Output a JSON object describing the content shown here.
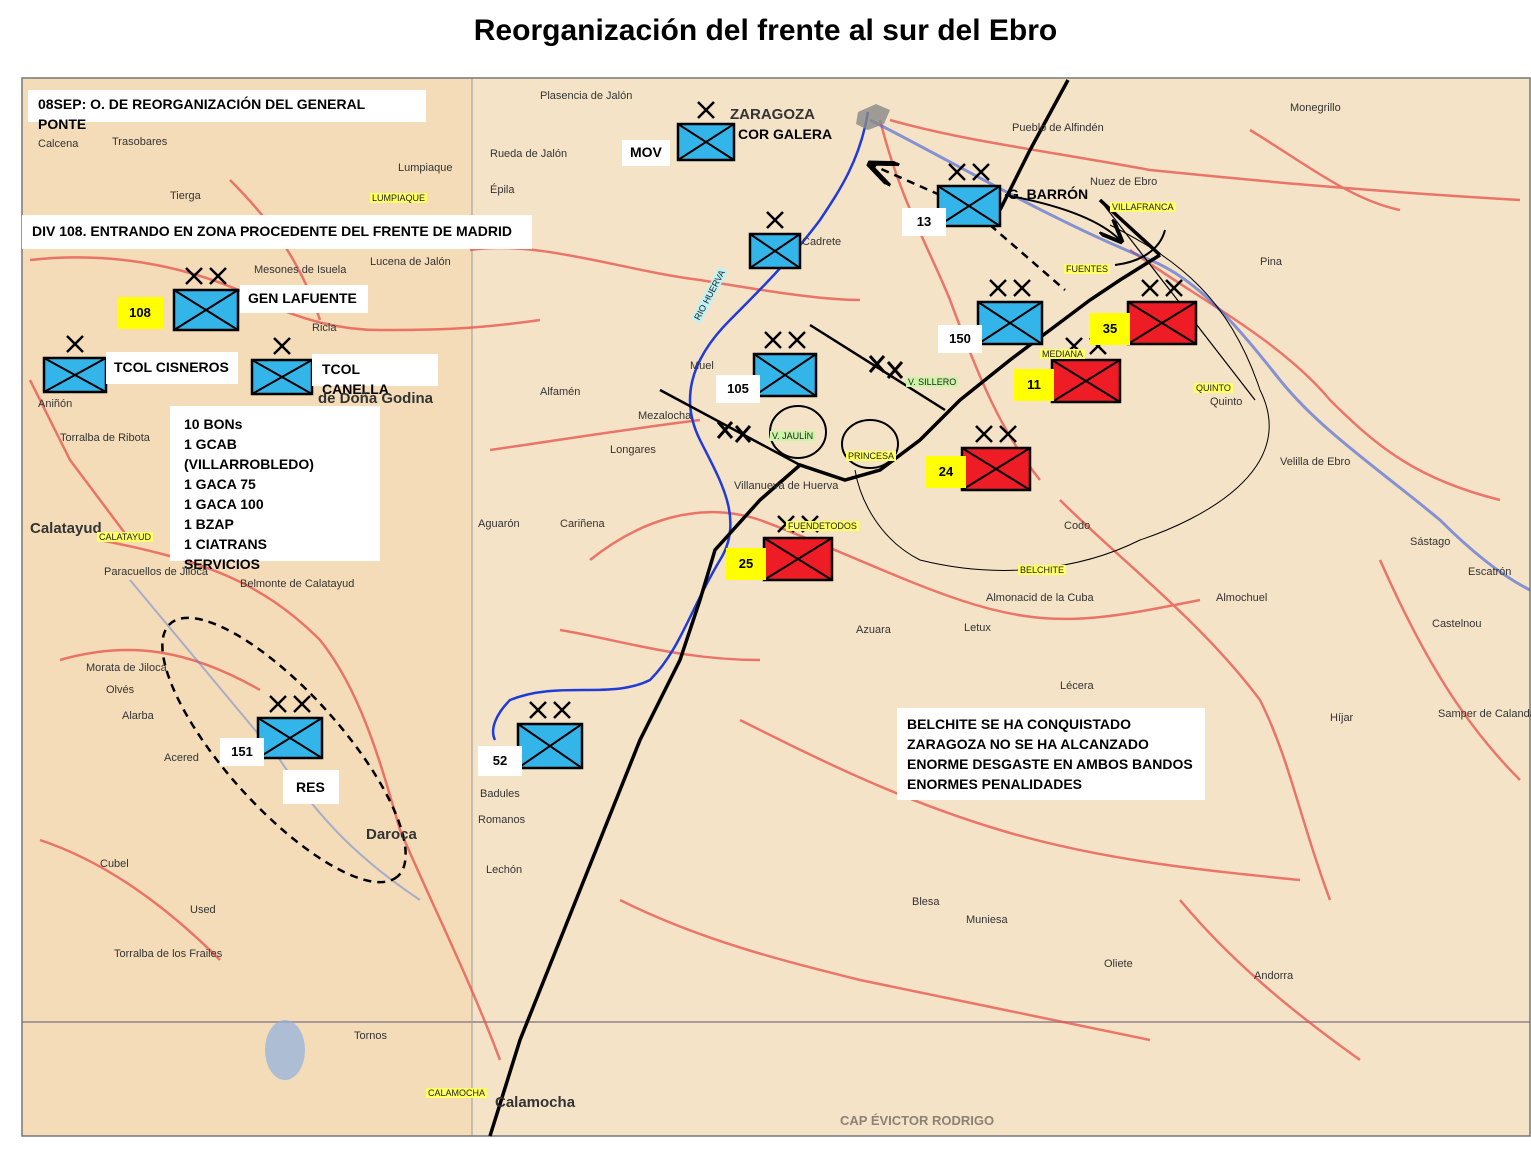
{
  "title": "Reorganización del frente al sur del Ebro",
  "notes": {
    "order": "08SEP: O. DE REORGANIZACIÓN DEL GENERAL PONTE",
    "div108": "DIV 108. ENTRANDO EN ZONA PROCEDENTE DEL FRENTE DE MADRID",
    "composition": [
      "10 BONs",
      "1 GCAB (VILLARROBLEDO)",
      "1 GACA 75",
      "1 GACA 100",
      "1 BZAP",
      "1 CIATRANS",
      "SERVICIOS"
    ],
    "summary": [
      "BELCHITE SE HA CONQUISTADO",
      "ZARAGOZA NO SE HA ALCANZADO",
      "ENORME DESGASTE EN AMBOS BANDOS",
      "ENORMES PENALIDADES"
    ]
  },
  "unit_labels": {
    "mov": "MOV",
    "cor_galera": "COR GALERA",
    "g_barron": "G. BARRÓN",
    "gen_lafuente": "GEN LAFUENTE",
    "tcol_cisneros": "TCOL CISNEROS",
    "tcol_canella": "TCOL CANELLA",
    "res": "RES"
  },
  "unit_numbers": {
    "u108": "108",
    "u13": "13",
    "u150": "150",
    "u105": "105",
    "u151": "151",
    "u52": "52",
    "u35": "35",
    "u11": "11",
    "u24": "24",
    "u25": "25"
  },
  "map_labels": {
    "zaragoza": "ZARAGOZA",
    "calatayud": "Calatayud",
    "calamocha": "Calamocha",
    "dona_godina": "de Doña Godina",
    "daroca": "Daroca",
    "rio_huerva": "RIO HUERVA",
    "villafranca": "VILLAFRANCA",
    "fuentes": "FUENTES",
    "mediana": "MEDIANA",
    "v_sillero": "V. SILLERO",
    "v_jaulin": "V. JAULÍN",
    "princesa": "PRINCESA",
    "fuendetodos": "FUENDETODOS",
    "belchite": "BELCHITE",
    "quinto": "QUINTO",
    "lumpiaque": "LUMPIAQUE",
    "calatayud_hl": "CALATAYUD",
    "calamocha_hl": "CALAMOCHA",
    "credit": "CAP ÉVICTOR RODRIGO"
  },
  "towns": {
    "t1": "Plasencia de Jalón",
    "t2": "Rueda de Jalón",
    "t3": "Épila",
    "t4": "Calcena",
    "t5": "Trasobares",
    "t6": "Tierga",
    "t7": "Lumpiaque",
    "t8": "Mesones de Isuela",
    "t9": "Lucena de Jalón",
    "t10": "Ricla",
    "t11": "Aniñón",
    "t12": "Torralba de Ribota",
    "t13": "Paracuellos de Jiloca",
    "t14": "Belmonte de Calatayud",
    "t15": "Morata de Jiloca",
    "t16": "Olvés",
    "t17": "Alarba",
    "t18": "Acered",
    "t19": "Cubel",
    "t20": "Torralba de los Frailes",
    "t21": "Used",
    "t22": "Tornos",
    "t23": "Pueblo de Alfindén",
    "t24": "Nuez de Ebro",
    "t25": "Monegrillo",
    "t26": "Pina",
    "t27": "Cariñena",
    "t28": "Longares",
    "t29": "Aguarón",
    "t30": "Azuara",
    "t31": "Lécera",
    "t32": "Almonacid de la Cuba",
    "t33": "Letux",
    "t34": "Samper de Calanda",
    "t35": "Híjar",
    "t36": "Escatrón",
    "t37": "Sástago",
    "t38": "Blesa",
    "t39": "Muniesa",
    "t40": "Oliete",
    "t41": "Andorra",
    "t42": "Lechón",
    "t43": "Badules",
    "t44": "Romanos",
    "t45": "Villanueva de Huerva",
    "t46": "Mezalocha",
    "t47": "Muel",
    "t48": "Cadrete",
    "t49": "Quinto",
    "t50": "Velilla de Ebro",
    "t51": "Codo",
    "t52": "Alfamén",
    "t53": "Almochuel",
    "t54": "Castelnou"
  },
  "colors": {
    "friendly": "#33b5ea",
    "enemy": "#ee1c24",
    "highlight": "#ffff00",
    "map_bg": "#f3dfc0",
    "river": "#1f3bd8",
    "road": "#e03b3b"
  },
  "icons": {
    "friendly_unit": "blue-nato-infantry-icon",
    "enemy_unit": "red-nato-infantry-icon",
    "brigade_mark": "single-x-icon",
    "division_mark": "double-x-icon"
  }
}
